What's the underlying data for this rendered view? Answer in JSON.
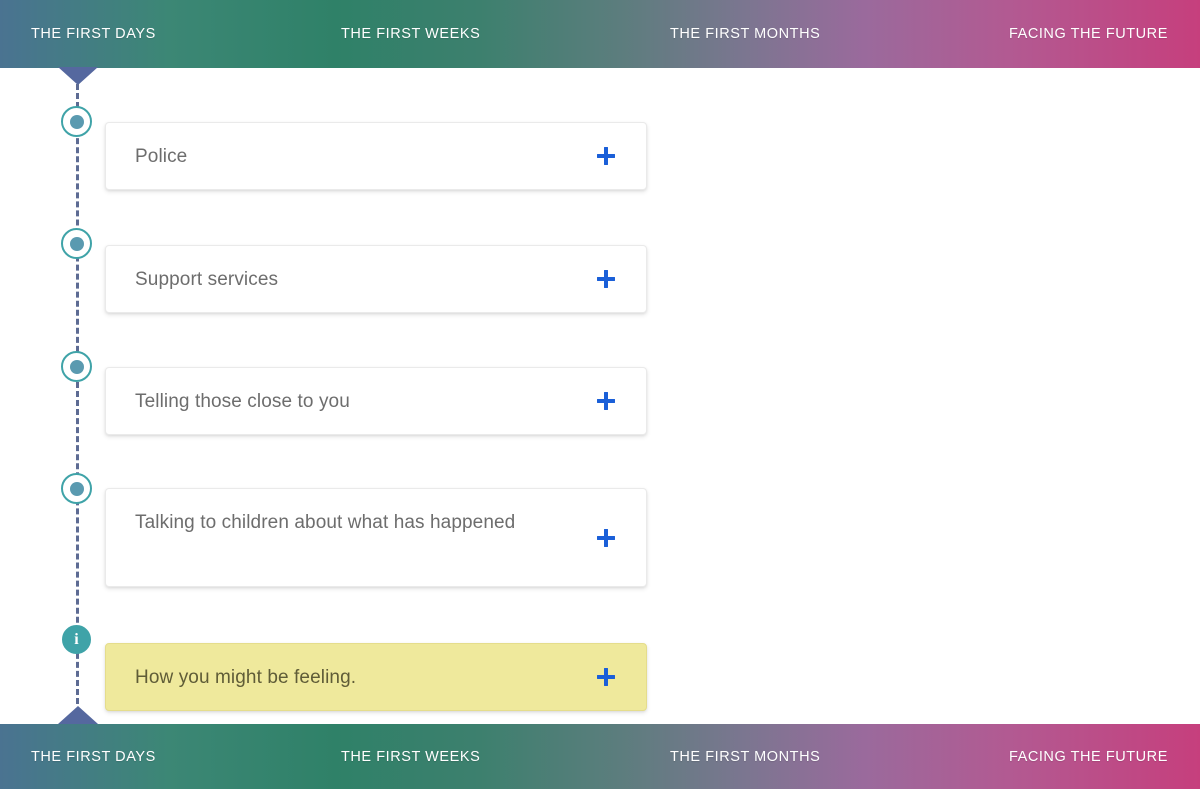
{
  "nav": {
    "items": [
      {
        "label": "THE FIRST DAYS"
      },
      {
        "label": "THE FIRST WEEKS"
      },
      {
        "label": "THE FIRST MONTHS"
      },
      {
        "label": "FACING THE FUTURE"
      }
    ],
    "gradient_start": "#4a7391",
    "gradient_mid": "#2f8168",
    "gradient_end": "#c63f7d"
  },
  "timeline": {
    "line_color": "#5d6b93",
    "marker_ring_color": "#3fa3a8",
    "marker_dot_color": "#5a9ab0",
    "arrow_color": "#55689f",
    "info_icon_glyph": "i"
  },
  "cards": [
    {
      "title": "Police",
      "marker": "dot",
      "highlighted": false,
      "expand_icon": "plus-icon"
    },
    {
      "title": "Support services",
      "marker": "dot",
      "highlighted": false,
      "expand_icon": "plus-icon"
    },
    {
      "title": "Telling those close to you",
      "marker": "dot",
      "highlighted": false,
      "expand_icon": "plus-icon"
    },
    {
      "title": "Talking to children about what has happened",
      "marker": "dot",
      "highlighted": false,
      "expand_icon": "plus-icon"
    },
    {
      "title": "How you might be feeling.",
      "marker": "info",
      "highlighted": true,
      "expand_icon": "plus-icon"
    }
  ],
  "accent": {
    "plus_color": "#1a5fd8",
    "highlight_bg": "#efe99c"
  }
}
